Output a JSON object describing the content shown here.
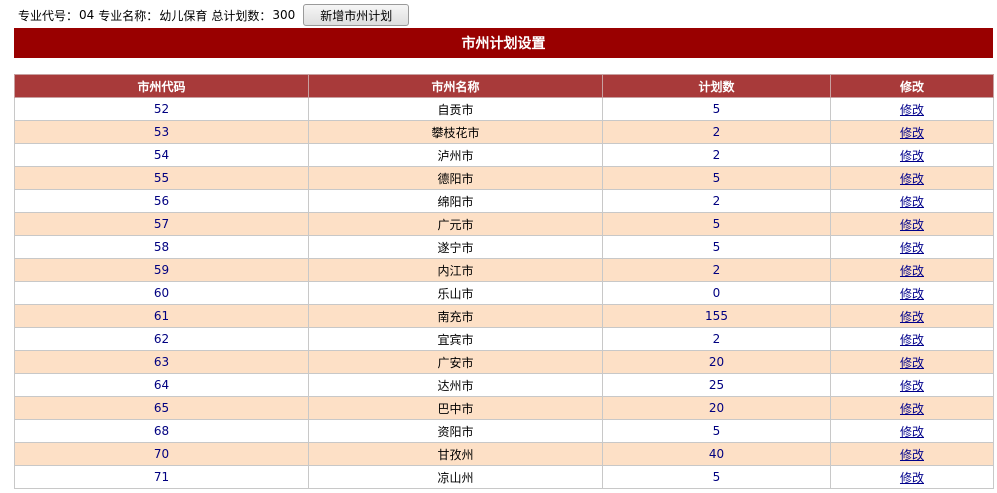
{
  "header": {
    "major_code_label": "专业代号：",
    "major_code": "04",
    "major_name_label": "专业名称：",
    "major_name": "幼儿保育",
    "total_plan_label": "总计划数：",
    "total_plan": "300",
    "add_button": "新增市州计划"
  },
  "banner_title": "市州计划设置",
  "table": {
    "columns": [
      "市州代码",
      "市州名称",
      "计划数",
      "修改"
    ],
    "rows": [
      {
        "code": "52",
        "name": "自贡市",
        "count": "5",
        "edit": "修改"
      },
      {
        "code": "53",
        "name": "攀枝花市",
        "count": "2",
        "edit": "修改"
      },
      {
        "code": "54",
        "name": "泸州市",
        "count": "2",
        "edit": "修改"
      },
      {
        "code": "55",
        "name": "德阳市",
        "count": "5",
        "edit": "修改"
      },
      {
        "code": "56",
        "name": "绵阳市",
        "count": "2",
        "edit": "修改"
      },
      {
        "code": "57",
        "name": "广元市",
        "count": "5",
        "edit": "修改"
      },
      {
        "code": "58",
        "name": "遂宁市",
        "count": "5",
        "edit": "修改"
      },
      {
        "code": "59",
        "name": "内江市",
        "count": "2",
        "edit": "修改"
      },
      {
        "code": "60",
        "name": "乐山市",
        "count": "0",
        "edit": "修改"
      },
      {
        "code": "61",
        "name": "南充市",
        "count": "155",
        "edit": "修改"
      },
      {
        "code": "62",
        "name": "宜宾市",
        "count": "2",
        "edit": "修改"
      },
      {
        "code": "63",
        "name": "广安市",
        "count": "20",
        "edit": "修改"
      },
      {
        "code": "64",
        "name": "达州市",
        "count": "25",
        "edit": "修改"
      },
      {
        "code": "65",
        "name": "巴中市",
        "count": "20",
        "edit": "修改"
      },
      {
        "code": "68",
        "name": "资阳市",
        "count": "5",
        "edit": "修改"
      },
      {
        "code": "70",
        "name": "甘孜州",
        "count": "40",
        "edit": "修改"
      },
      {
        "code": "71",
        "name": "凉山州",
        "count": "5",
        "edit": "修改"
      }
    ]
  },
  "colors": {
    "banner": "#990000",
    "table_header": "#a83a3a",
    "row_alt": "#fde0c6",
    "link": "#00008b"
  }
}
